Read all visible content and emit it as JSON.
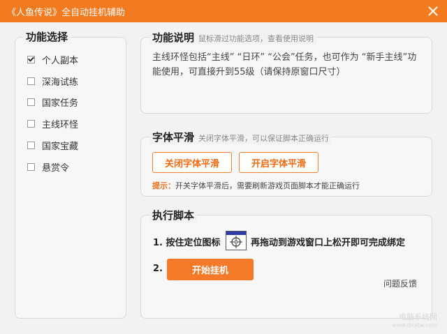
{
  "window": {
    "title": "《人鱼传说》全自动挂机辅助",
    "accent": "#f47a1f"
  },
  "features": {
    "legend": "功能选择",
    "items": [
      {
        "label": "个人副本",
        "checked": true
      },
      {
        "label": "深海试练",
        "checked": false
      },
      {
        "label": "国家任务",
        "checked": false
      },
      {
        "label": "主线环怪",
        "checked": false
      },
      {
        "label": "国家宝藏",
        "checked": false
      },
      {
        "label": "悬赏令",
        "checked": false
      }
    ]
  },
  "info": {
    "legend": "功能说明",
    "hint": "鼠标滑过功能选项，查看使用说明",
    "text": "主线环怪包括“主线” “日环” “公会”任务，也可作为 “新手主线”功能使用，可直接升到55级（请保持原窗口尺寸）"
  },
  "font_smoothing": {
    "legend": "字体平滑",
    "hint": "关闭字体平滑，可以保证脚本正确运行",
    "close_button": "关闭字体平滑",
    "open_button": "开启字体平滑",
    "tip_label": "提示：",
    "tip_text": "开关字体平滑后，需要刷新游戏页面脚本才能正确运行"
  },
  "execute": {
    "legend": "执行脚本",
    "step1_prefix": "1. 按住定位图标",
    "step1_suffix": "再拖动到游戏窗口上松开即可完成绑定",
    "step2_label": "2.",
    "start_button": "开始挂机",
    "feedback": "问题反馈"
  },
  "watermark": {
    "line1": "电脑系统网",
    "line2": "www.dnxtw.com"
  }
}
